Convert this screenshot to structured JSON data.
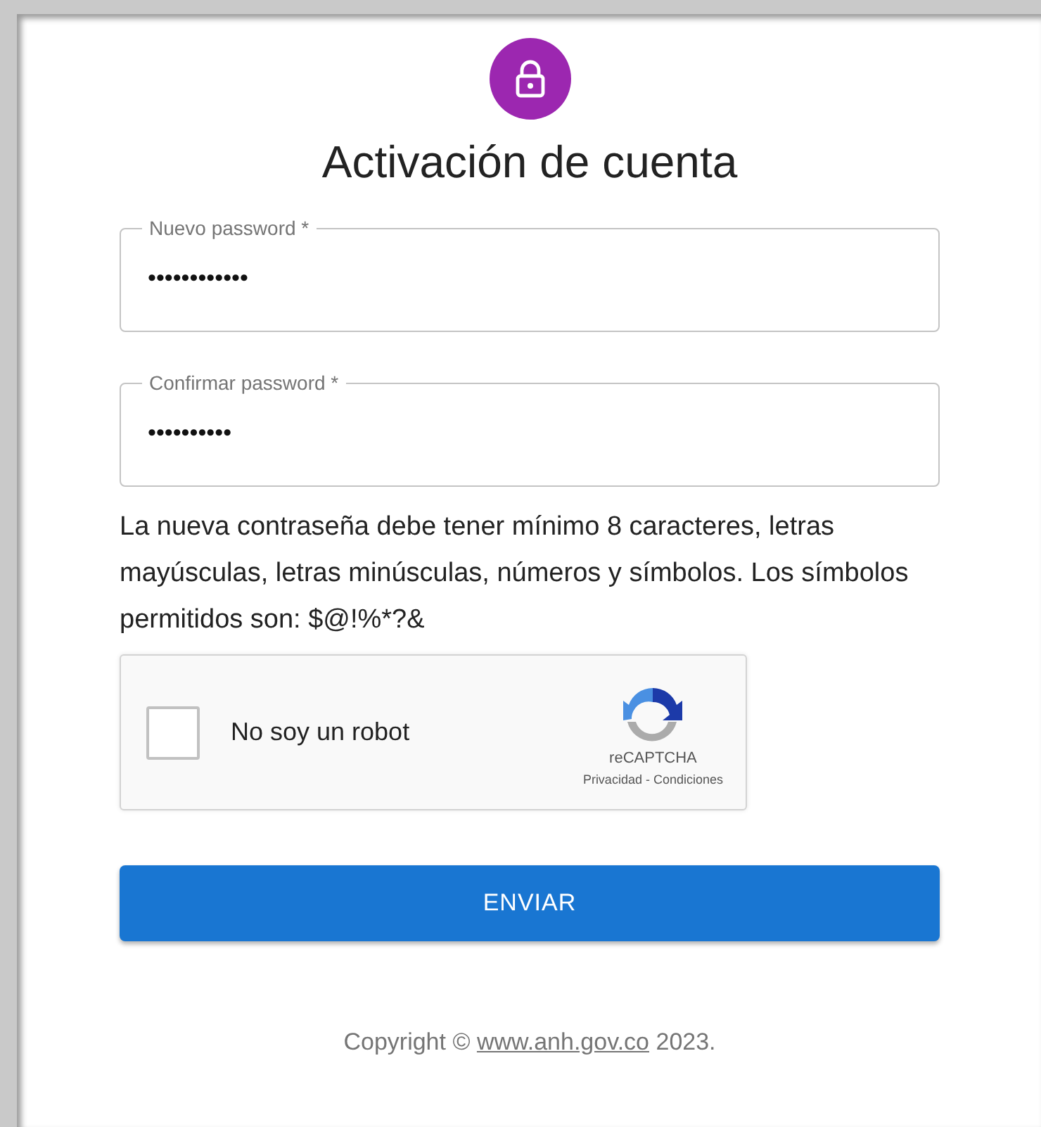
{
  "title": "Activación de cuenta",
  "fields": [
    {
      "label": "Nuevo password *",
      "value": "••••••••••••"
    },
    {
      "label": "Confirmar password *",
      "value": "••••••••••"
    }
  ],
  "hint": "La nueva contraseña debe tener mínimo 8 caracteres, letras mayúsculas, letras minúsculas, números y símbolos. Los símbolos permitidos son: $@!%*?&",
  "captcha": {
    "label": "No soy un robot",
    "checked": false,
    "brand": "reCAPTCHA",
    "links": "Privacidad - Condiciones"
  },
  "submit": "ENVIAR",
  "footer": {
    "prefix": "Copyright ©",
    "link": "www.anh.gov.co",
    "suffix": "2023."
  }
}
